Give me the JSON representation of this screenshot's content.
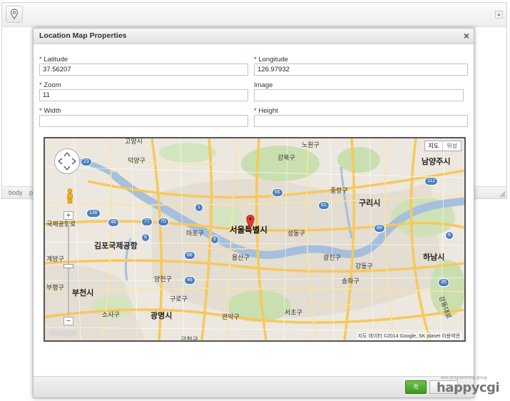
{
  "editor": {
    "status_path": "body",
    "status_path_2": "p"
  },
  "dialog": {
    "title": "Location Map Properties",
    "close_glyph": "×",
    "required_mark": "*",
    "fields": {
      "latitude": {
        "label": "Latitude",
        "value": "37.56207",
        "required": true
      },
      "longitude": {
        "label": "Longitude",
        "value": "126.97932",
        "required": true
      },
      "zoom": {
        "label": "Zoom",
        "value": "11",
        "required": true
      },
      "image": {
        "label": "Image",
        "value": "",
        "required": false
      },
      "width": {
        "label": "Width",
        "value": "",
        "required": true
      },
      "height": {
        "label": "Height",
        "value": "",
        "required": true
      }
    },
    "ok_label": "확"
  },
  "map": {
    "type_map": "지도",
    "type_satellite": "위성",
    "attribution": "지도 데이터 ©2014 Google, SK planet   이용약관",
    "google_logo": "Google",
    "zoom_in": "+",
    "zoom_out": "−",
    "labels": {
      "center": "서울특별시",
      "namyangju": "남양주시",
      "guri": "구리시",
      "hanam": "하남시",
      "bucheon": "부천시",
      "gwangmyeong": "광명시",
      "gimpo_airport": "김포국제공항",
      "mapo": "마포구",
      "seongdong": "성동구",
      "yongsan": "용산구",
      "gwangjin": "광진구",
      "songpa": "송파구",
      "gangdong": "강동구",
      "seocho": "서초구",
      "gangbuk": "강북구",
      "nowon": "노원구",
      "jungnang": "중랑구",
      "deogyang": "덕양구",
      "yangcheon": "양천구",
      "guro": "구로구",
      "sosa": "소사구",
      "gwanak": "관악구",
      "geumcheon": "금천구",
      "gyeyang": "계양구",
      "bupyeong": "부평구",
      "goyang": "고양시",
      "incheon_airport": "국제공항로",
      "gangdong_road": "강동대로"
    },
    "shields": [
      "23",
      "130",
      "48",
      "77",
      "70",
      "6",
      "1",
      "8",
      "88",
      "46",
      "66",
      "61",
      "112",
      "88",
      "6",
      "35"
    ]
  },
  "watermark": {
    "small": "web programming group",
    "logo": "happycgi"
  },
  "colors": {
    "water": "#a5bfdd",
    "road_major": "#f7c85b",
    "park": "#c9dfaf",
    "ok_button": "#4caf2a"
  }
}
